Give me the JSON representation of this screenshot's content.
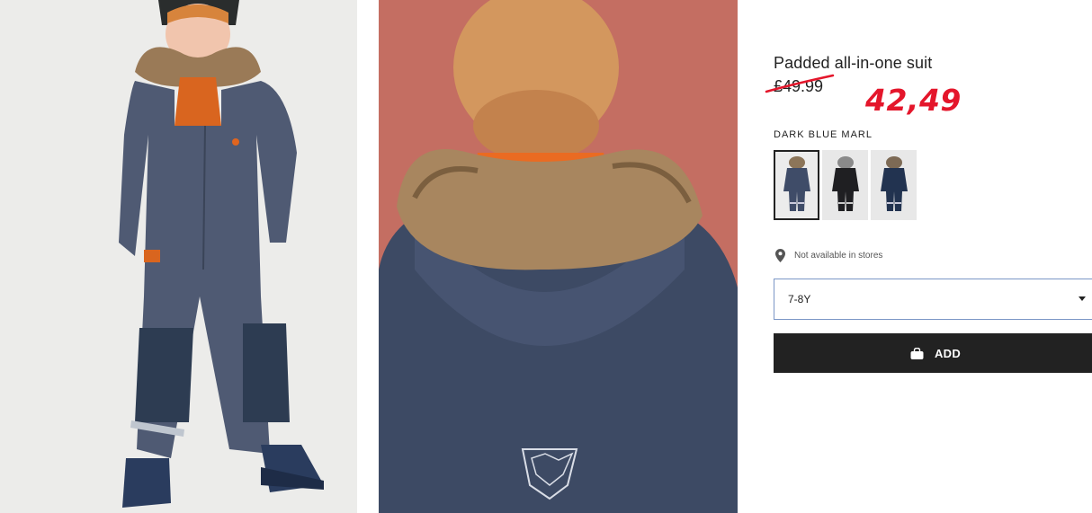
{
  "product": {
    "title": "Padded all-in-one suit",
    "old_price": "£49.99",
    "new_price": "42,49",
    "color_name": "DARK BLUE MARL",
    "swatches": [
      {
        "color": "dark blue marl",
        "selected": true
      },
      {
        "color": "black",
        "selected": false
      },
      {
        "color": "dark blue",
        "selected": false
      }
    ],
    "store_availability": "Not available in stores",
    "size": {
      "selected": "7-8Y"
    },
    "add_button": {
      "label": "ADD"
    }
  },
  "colors": {
    "accent_red": "#e4162b",
    "button_bg": "#222222",
    "select_border": "#7b96c6"
  },
  "icons": {
    "location": "location-pin-icon",
    "bag": "shopping-bag-icon",
    "caret": "chevron-down-icon"
  }
}
